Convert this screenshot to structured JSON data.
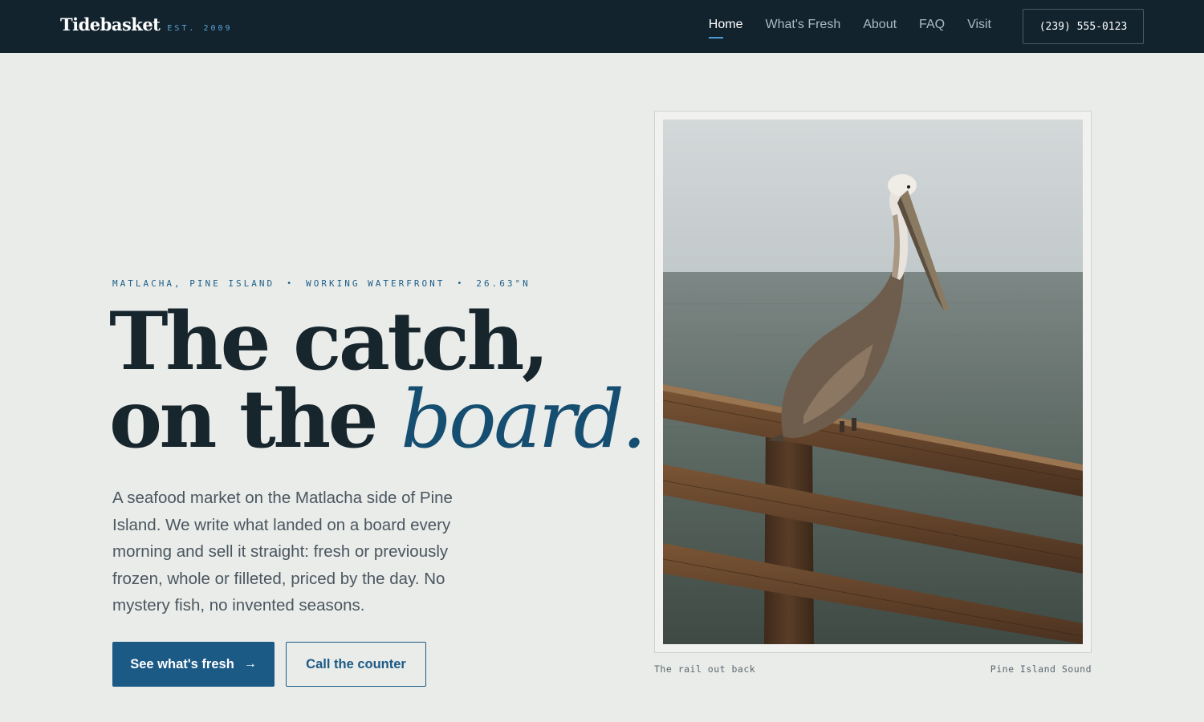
{
  "header": {
    "brand_name": "Tidebasket",
    "brand_est": "EST. 2009",
    "nav": [
      {
        "label": "Home",
        "active": true
      },
      {
        "label": "What's Fresh",
        "active": false
      },
      {
        "label": "About",
        "active": false
      },
      {
        "label": "FAQ",
        "active": false
      },
      {
        "label": "Visit",
        "active": false
      }
    ],
    "phone": "(239) 555-0123"
  },
  "hero": {
    "eyebrow": [
      "MATLACHA, PINE ISLAND",
      "WORKING WATERFRONT",
      "26.63°N"
    ],
    "eyebrow_separator": "•",
    "headline_line1": "The catch,",
    "headline_line2": "on the ",
    "headline_accent": "board.",
    "lede": "A seafood market on the Matlacha side of Pine Island. We write what landed on a board every morning and sell it straight: fresh or previously frozen, whole or filleted, priced by the day. No mystery fish, no invented seasons.",
    "primary_cta": "See what's fresh",
    "primary_cta_icon": "arrow-right-icon",
    "secondary_cta": "Call the counter"
  },
  "photo": {
    "subject": "pelican-on-rail-photo",
    "caption_left": "The rail out back",
    "caption_right": "Pine Island Sound"
  },
  "colors": {
    "nav_bg": "#12232e",
    "page_bg": "#eaece9",
    "accent": "#1c5a86",
    "accent_light": "#4d9bd6",
    "headline": "#17252d"
  }
}
